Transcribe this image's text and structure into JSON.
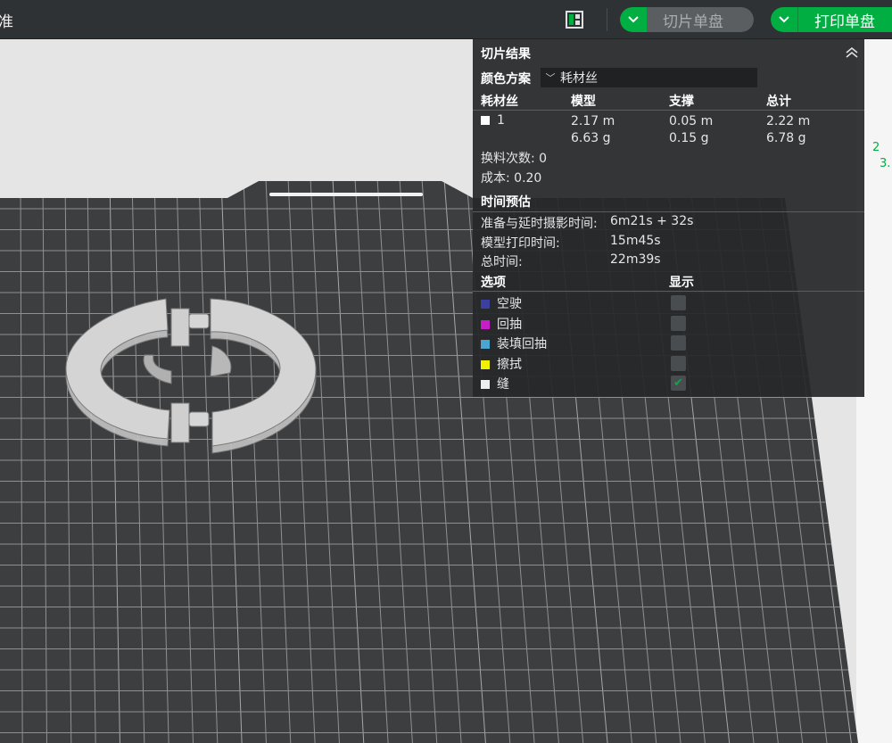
{
  "topbar": {
    "left_text": "准",
    "slice_label": "切片单盘",
    "print_label": "打印单盘"
  },
  "panel": {
    "title": "切片结果",
    "color_scheme_label": "颜色方案",
    "color_scheme_value": "耗材丝",
    "table_headers": [
      "耗材丝",
      "模型",
      "支撑",
      "总计"
    ],
    "filament_row": {
      "id": "1",
      "model": [
        "2.17 m",
        "6.63 g"
      ],
      "support": [
        "0.05 m",
        "0.15 g"
      ],
      "total": [
        "2.22 m",
        "6.78 g"
      ]
    },
    "swaps": "换料次数: 0",
    "cost": "成本: 0.20",
    "time_title": "时间预估",
    "time_rows": [
      {
        "label": "准备与延时摄影时间:",
        "value": "6m21s + 32s"
      },
      {
        "label": "模型打印时间:",
        "value": "15m45s"
      },
      {
        "label": "总时间:",
        "value": "22m39s"
      }
    ],
    "options_header": "选项",
    "display_header": "显示",
    "options": [
      {
        "label": "空驶",
        "color": "#3a3fa0",
        "checked": false
      },
      {
        "label": "回抽",
        "color": "#c81ec8",
        "checked": false
      },
      {
        "label": "装填回抽",
        "color": "#4aa6cf",
        "checked": false
      },
      {
        "label": "擦拭",
        "color": "#f0f000",
        "checked": false
      },
      {
        "label": "缝",
        "color": "#eeeeee",
        "checked": true
      }
    ]
  },
  "side_numbers": [
    "2",
    "3."
  ]
}
